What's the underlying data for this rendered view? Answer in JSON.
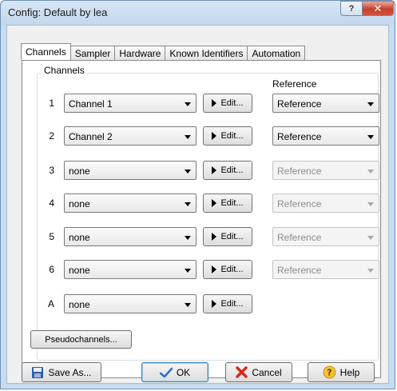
{
  "window": {
    "title": "Config: Default by lea",
    "help_glyph": "?",
    "close_glyph": "✕"
  },
  "tabs": [
    {
      "label": "Channels",
      "active": true
    },
    {
      "label": "Sampler",
      "active": false
    },
    {
      "label": "Hardware",
      "active": false
    },
    {
      "label": "Known Identifiers",
      "active": false
    },
    {
      "label": "Automation",
      "active": false
    }
  ],
  "channels_group": {
    "label": "Channels",
    "reference_header": "Reference"
  },
  "rows": [
    {
      "num": "1",
      "channel": "Channel 1",
      "edit": "Edit...",
      "reference": "Reference",
      "ref_enabled": true
    },
    {
      "num": "2",
      "channel": "Channel 2",
      "edit": "Edit...",
      "reference": "Reference",
      "ref_enabled": true
    },
    {
      "num": "3",
      "channel": "none",
      "edit": "Edit...",
      "reference": "Reference",
      "ref_enabled": false
    },
    {
      "num": "4",
      "channel": "none",
      "edit": "Edit...",
      "reference": "Reference",
      "ref_enabled": false
    },
    {
      "num": "5",
      "channel": "none",
      "edit": "Edit...",
      "reference": "Reference",
      "ref_enabled": false
    },
    {
      "num": "6",
      "channel": "none",
      "edit": "Edit...",
      "reference": "Reference",
      "ref_enabled": false
    },
    {
      "num": "A",
      "channel": "none",
      "edit": "Edit..."
    }
  ],
  "pseudo_button": "Pseudochannels...",
  "buttons": {
    "save_as": "Save As...",
    "ok": "OK",
    "cancel": "Cancel",
    "help": "Help"
  },
  "colors": {
    "frame": "#c9dcef",
    "close": "#c7402d",
    "default_button": "#3c7fb1"
  }
}
